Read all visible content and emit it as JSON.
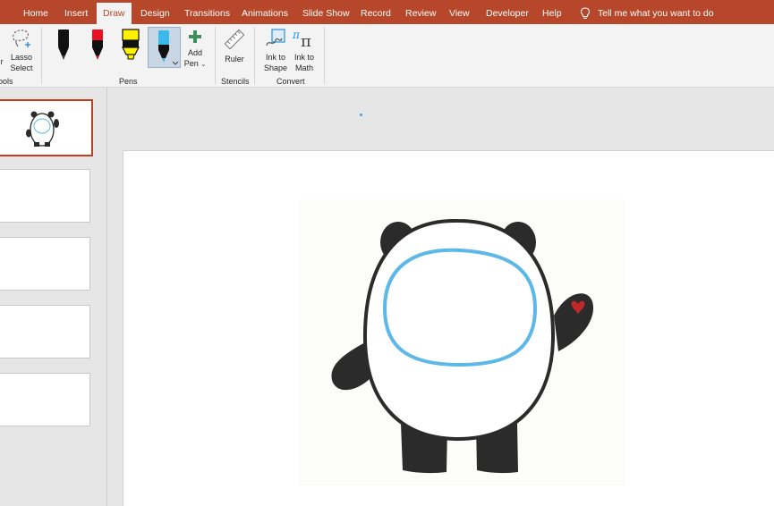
{
  "tabs": [
    {
      "label": "Home"
    },
    {
      "label": "Insert"
    },
    {
      "label": "Draw",
      "active": true
    },
    {
      "label": "Design"
    },
    {
      "label": "Transitions"
    },
    {
      "label": "Animations"
    },
    {
      "label": "Slide Show"
    },
    {
      "label": "Record"
    },
    {
      "label": "Review"
    },
    {
      "label": "View"
    },
    {
      "label": "Developer"
    },
    {
      "label": "Help"
    }
  ],
  "tell_me": "Tell me what you want to do",
  "ribbon": {
    "tools_group": {
      "lasso_line1": "Lasso",
      "lasso_line2": "Select",
      "label": "ools",
      "partial_left": "r"
    },
    "pens_group": {
      "label": "Pens",
      "pens": [
        {
          "name": "black-pen",
          "color": "#000000"
        },
        {
          "name": "red-pen",
          "color": "#e81123"
        },
        {
          "name": "yellow-highlighter",
          "color": "#fff100"
        },
        {
          "name": "blue-pen",
          "color": "#3bb9ec",
          "selected": true
        }
      ],
      "add_pen_line1": "Add",
      "add_pen_line2": "Pen"
    },
    "stencils_group": {
      "label": "Stencils",
      "ruler": "Ruler"
    },
    "convert_group": {
      "label": "Convert",
      "ink_to_shape_line1": "Ink to",
      "ink_to_shape_line2": "Shape",
      "ink_to_math_line1": "Ink to",
      "ink_to_math_line2": "Math"
    }
  },
  "thumbnails": [
    {
      "selected": true
    },
    {
      "selected": false
    },
    {
      "selected": false
    },
    {
      "selected": false
    },
    {
      "selected": false
    }
  ],
  "colors": {
    "accent": "#b7472a",
    "selection_border": "#c43e1c",
    "panda_outline": "#2b2b2b",
    "face_outline": "#5bb8e8",
    "heart": "#c0282b"
  }
}
